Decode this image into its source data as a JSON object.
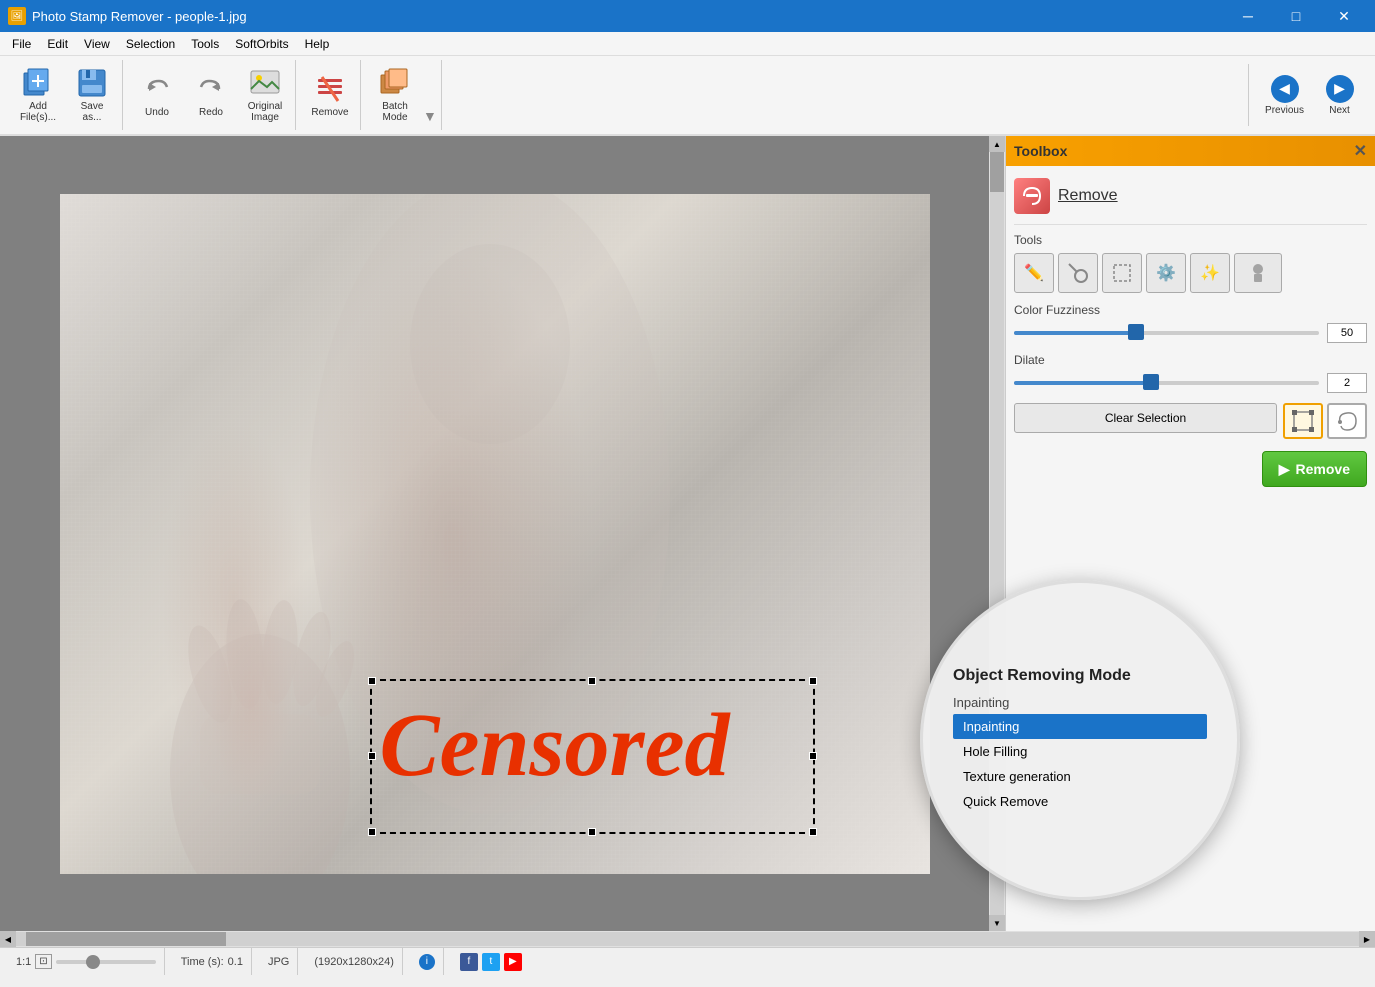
{
  "titlebar": {
    "title": "Photo Stamp Remover - people-1.jpg",
    "icon": "PSR",
    "controls": {
      "minimize": "─",
      "maximize": "□",
      "close": "✕"
    }
  },
  "menubar": {
    "items": [
      "File",
      "Edit",
      "View",
      "Selection",
      "Tools",
      "SoftOrbits",
      "Help"
    ]
  },
  "toolbar": {
    "add_files_label": "Add\nFile(s)...",
    "save_as_label": "Save\nas...",
    "undo_label": "Undo",
    "redo_label": "Redo",
    "original_image_label": "Original\nImage",
    "remove_label": "Remove",
    "batch_mode_label": "Batch\nMode"
  },
  "nav": {
    "previous_label": "Previous",
    "next_label": "Next"
  },
  "toolbox": {
    "title": "Toolbox",
    "close_btn": "✕",
    "remove_title": "Remove",
    "tools_label": "Tools",
    "color_fuzziness_label": "Color Fuzziness",
    "color_fuzziness_value": "50",
    "color_fuzziness_pct": 40,
    "dilate_label": "Dilate",
    "dilate_value": "2",
    "dilate_pct": 45,
    "clear_selection_label": "Clear Selection",
    "remove_button_label": "Remove"
  },
  "dropdown": {
    "title": "Object Removing Mode",
    "current_value": "Inpainting",
    "options": [
      "Inpainting",
      "Hole Filling",
      "Texture generation",
      "Quick Remove"
    ],
    "selected_index": 0
  },
  "statusbar": {
    "zoom": "1:1",
    "fit_icon": "⊡",
    "time_label": "Time (s):",
    "time_value": "0.1",
    "format": "JPG",
    "dimensions": "(1920x1280x24)",
    "info": "i"
  },
  "censored_text": "Censored"
}
